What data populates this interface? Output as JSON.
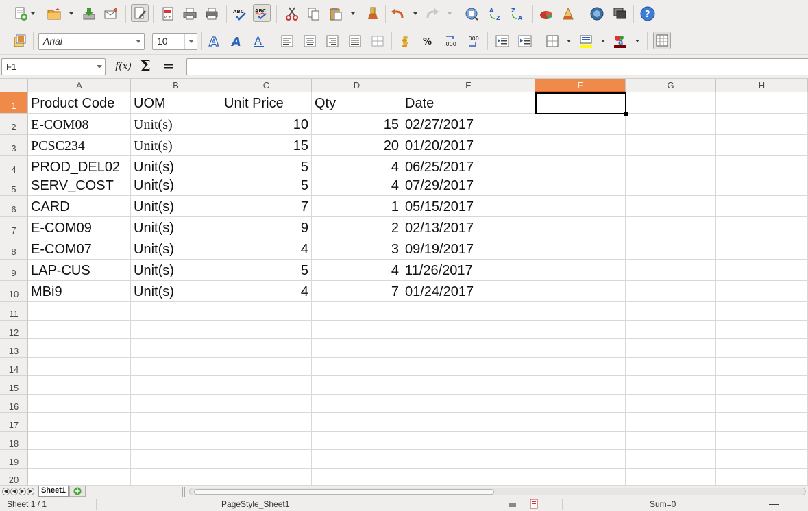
{
  "toolbar_standard": {
    "icons": [
      "new-document-icon",
      "open-folder-icon",
      "save-icon",
      "email-icon",
      "edit-mode-icon",
      "export-pdf-icon",
      "print-icon",
      "print-preview-icon",
      "spellcheck-icon",
      "autospell-icon",
      "cut-icon",
      "copy-icon",
      "paste-icon",
      "clone-formatting-icon",
      "undo-icon",
      "redo-icon",
      "navigator-icon",
      "sort-ascending-icon",
      "sort-descending-icon",
      "chart-icon",
      "draw-functions-icon",
      "gallery-icon",
      "data-sources-icon",
      "help-icon"
    ]
  },
  "toolbar_formatting": {
    "font_name": "Arial",
    "font_size": "10",
    "icons": [
      "styles-icon",
      "bold-icon",
      "italic-icon",
      "underline-icon",
      "align-left-icon",
      "align-center-icon",
      "align-right-icon",
      "justify-icon",
      "merge-cells-icon",
      "currency-icon",
      "percent-icon",
      "decimal-add-icon",
      "decimal-delete-icon",
      "indent-decrease-icon",
      "indent-increase-icon",
      "borders-icon",
      "background-color-icon",
      "font-color-icon",
      "toggle-grid-icon"
    ]
  },
  "formula_bar": {
    "name_box": "F1",
    "function_wizard": "f(x)",
    "sum": "Σ",
    "equals": "=",
    "content": ""
  },
  "sheet": {
    "columns": [
      "A",
      "B",
      "C",
      "D",
      "E",
      "F",
      "G",
      "H"
    ],
    "selected_column": "F",
    "selected_row": 1,
    "row_numbers": [
      "1",
      "2",
      "3",
      "4",
      "5",
      "6",
      "7",
      "8",
      "9",
      "10",
      "11",
      "12",
      "13",
      "14",
      "15",
      "16",
      "17",
      "18",
      "19",
      "20"
    ],
    "rows": [
      [
        "Product Code",
        "UOM",
        "Unit Price",
        "Qty",
        "Date"
      ],
      [
        "E-COM08",
        "Unit(s)",
        "10",
        "15",
        "02/27/2017"
      ],
      [
        "PCSC234",
        "Unit(s)",
        "15",
        "20",
        "01/20/2017"
      ],
      [
        "PROD_DEL02",
        "Unit(s)",
        "5",
        "4",
        "06/25/2017"
      ],
      [
        "SERV_COST",
        "Unit(s)",
        "5",
        "4",
        "07/29/2017"
      ],
      [
        "CARD",
        "Unit(s)",
        "7",
        "1",
        "05/15/2017"
      ],
      [
        "E-COM09",
        "Unit(s)",
        "9",
        "2",
        "02/13/2017"
      ],
      [
        "E-COM07",
        "Unit(s)",
        "4",
        "3",
        "09/19/2017"
      ],
      [
        "LAP-CUS",
        "Unit(s)",
        "5",
        "4",
        "11/26/2017"
      ],
      [
        "MBi9",
        "Unit(s)",
        "4",
        "7",
        "01/24/2017"
      ]
    ]
  },
  "tabs": {
    "sheet_tab": "Sheet1"
  },
  "status": {
    "sheet_position": "Sheet 1 / 1",
    "page_style": "PageStyle_Sheet1",
    "sum": "Sum=0"
  },
  "colors": {
    "selection_header": "#f08a4b",
    "toolbar_bg": "#efeeed"
  }
}
